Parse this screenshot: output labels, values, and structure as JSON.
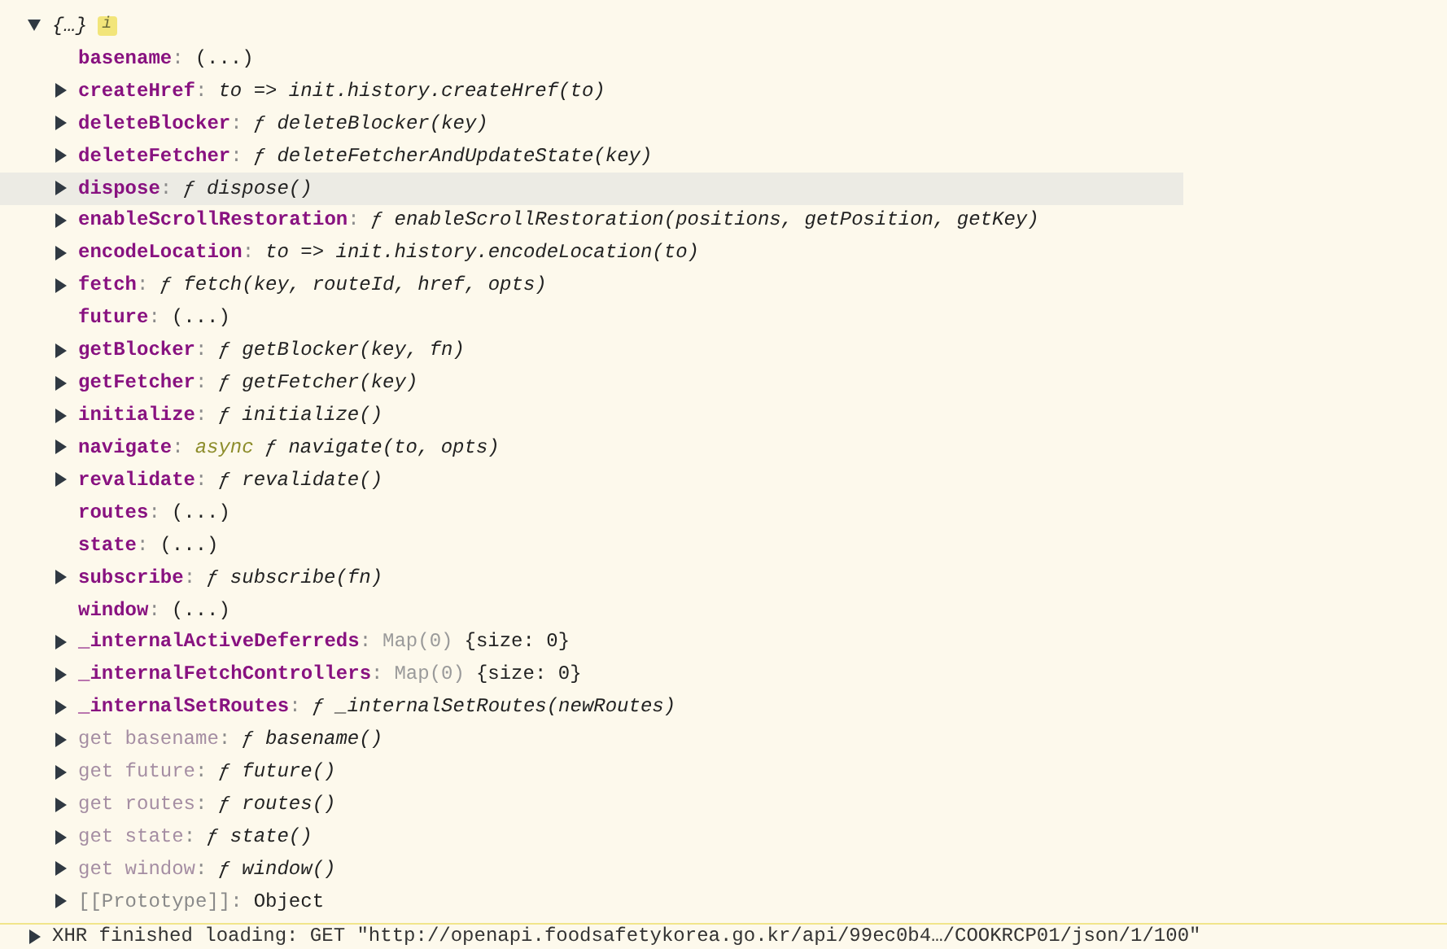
{
  "root": {
    "label": "{…}",
    "expanded": true,
    "badge": "i"
  },
  "properties": [
    {
      "name": "basename",
      "separator": ":",
      "kind": "own",
      "expandable": false,
      "hovered": false,
      "value": [
        {
          "kind": "plain",
          "text": "(...)"
        }
      ]
    },
    {
      "name": "createHref",
      "separator": ":",
      "kind": "own",
      "expandable": true,
      "hovered": false,
      "value": [
        {
          "kind": "italic",
          "text": "to => init.history.createHref(to)"
        }
      ]
    },
    {
      "name": "deleteBlocker",
      "separator": ":",
      "kind": "own",
      "expandable": true,
      "hovered": false,
      "value": [
        {
          "kind": "italic",
          "text": "ƒ deleteBlocker(key)"
        }
      ]
    },
    {
      "name": "deleteFetcher",
      "separator": ":",
      "kind": "own",
      "expandable": true,
      "hovered": false,
      "value": [
        {
          "kind": "italic",
          "text": "ƒ deleteFetcherAndUpdateState(key)"
        }
      ]
    },
    {
      "name": "dispose",
      "separator": ":",
      "kind": "own",
      "expandable": true,
      "hovered": true,
      "value": [
        {
          "kind": "italic",
          "text": "ƒ dispose()"
        }
      ]
    },
    {
      "name": "enableScrollRestoration",
      "separator": ":",
      "kind": "own",
      "expandable": true,
      "hovered": false,
      "value": [
        {
          "kind": "italic",
          "text": "ƒ enableScrollRestoration(positions, getPosition, getKey)"
        }
      ]
    },
    {
      "name": "encodeLocation",
      "separator": ":",
      "kind": "own",
      "expandable": true,
      "hovered": false,
      "value": [
        {
          "kind": "italic",
          "text": "to => init.history.encodeLocation(to)"
        }
      ]
    },
    {
      "name": "fetch",
      "separator": ":",
      "kind": "own",
      "expandable": true,
      "hovered": false,
      "value": [
        {
          "kind": "italic",
          "text": "ƒ fetch(key, routeId, href, opts)"
        }
      ]
    },
    {
      "name": "future",
      "separator": ":",
      "kind": "own",
      "expandable": false,
      "hovered": false,
      "value": [
        {
          "kind": "plain",
          "text": "(...)"
        }
      ]
    },
    {
      "name": "getBlocker",
      "separator": ":",
      "kind": "own",
      "expandable": true,
      "hovered": false,
      "value": [
        {
          "kind": "italic",
          "text": "ƒ getBlocker(key, fn)"
        }
      ]
    },
    {
      "name": "getFetcher",
      "separator": ":",
      "kind": "own",
      "expandable": true,
      "hovered": false,
      "value": [
        {
          "kind": "italic",
          "text": "ƒ getFetcher(key)"
        }
      ]
    },
    {
      "name": "initialize",
      "separator": ":",
      "kind": "own",
      "expandable": true,
      "hovered": false,
      "value": [
        {
          "kind": "italic",
          "text": "ƒ initialize()"
        }
      ]
    },
    {
      "name": "navigate",
      "separator": ":",
      "kind": "own",
      "expandable": true,
      "hovered": false,
      "value": [
        {
          "kind": "keyword",
          "text": "async"
        },
        {
          "kind": "italic",
          "text": "ƒ navigate(to, opts)"
        }
      ]
    },
    {
      "name": "revalidate",
      "separator": ":",
      "kind": "own",
      "expandable": true,
      "hovered": false,
      "value": [
        {
          "kind": "italic",
          "text": "ƒ revalidate()"
        }
      ]
    },
    {
      "name": "routes",
      "separator": ":",
      "kind": "own",
      "expandable": false,
      "hovered": false,
      "value": [
        {
          "kind": "plain",
          "text": "(...)"
        }
      ]
    },
    {
      "name": "state",
      "separator": ":",
      "kind": "own",
      "expandable": false,
      "hovered": false,
      "value": [
        {
          "kind": "plain",
          "text": "(...)"
        }
      ]
    },
    {
      "name": "subscribe",
      "separator": ":",
      "kind": "own",
      "expandable": true,
      "hovered": false,
      "value": [
        {
          "kind": "italic",
          "text": "ƒ subscribe(fn)"
        }
      ]
    },
    {
      "name": "window",
      "separator": ":",
      "kind": "own",
      "expandable": false,
      "hovered": false,
      "value": [
        {
          "kind": "plain",
          "text": "(...)"
        }
      ]
    },
    {
      "name": "_internalActiveDeferreds",
      "separator": ":",
      "kind": "own",
      "expandable": true,
      "hovered": false,
      "value": [
        {
          "kind": "muted",
          "text": "Map(0)"
        },
        {
          "kind": "plain",
          "text": "{size: 0}"
        }
      ]
    },
    {
      "name": "_internalFetchControllers",
      "separator": ":",
      "kind": "own",
      "expandable": true,
      "hovered": false,
      "value": [
        {
          "kind": "muted",
          "text": "Map(0)"
        },
        {
          "kind": "plain",
          "text": "{size: 0}"
        }
      ]
    },
    {
      "name": "_internalSetRoutes",
      "separator": ":",
      "kind": "own",
      "expandable": true,
      "hovered": false,
      "value": [
        {
          "kind": "italic",
          "text": "ƒ _internalSetRoutes(newRoutes)"
        }
      ]
    },
    {
      "name": "get basename",
      "separator": ":",
      "kind": "accessor",
      "expandable": true,
      "hovered": false,
      "value": [
        {
          "kind": "italic",
          "text": "ƒ basename()"
        }
      ]
    },
    {
      "name": "get future",
      "separator": ":",
      "kind": "accessor",
      "expandable": true,
      "hovered": false,
      "value": [
        {
          "kind": "italic",
          "text": "ƒ future()"
        }
      ]
    },
    {
      "name": "get routes",
      "separator": ":",
      "kind": "accessor",
      "expandable": true,
      "hovered": false,
      "value": [
        {
          "kind": "italic",
          "text": "ƒ routes()"
        }
      ]
    },
    {
      "name": "get state",
      "separator": ":",
      "kind": "accessor",
      "expandable": true,
      "hovered": false,
      "value": [
        {
          "kind": "italic",
          "text": "ƒ state()"
        }
      ]
    },
    {
      "name": "get window",
      "separator": ":",
      "kind": "accessor",
      "expandable": true,
      "hovered": false,
      "value": [
        {
          "kind": "italic",
          "text": "ƒ window()"
        }
      ]
    },
    {
      "name": "[[Prototype]]",
      "separator": ":",
      "kind": "internal",
      "expandable": true,
      "hovered": false,
      "value": [
        {
          "kind": "plain",
          "text": "Object"
        }
      ]
    }
  ],
  "log_message": {
    "expanded": false,
    "text": "XHR finished loading: GET \"http://openapi.foodsafetykorea.go.kr/api/99ec0b4…/COOKRCP01/json/1/100\""
  }
}
